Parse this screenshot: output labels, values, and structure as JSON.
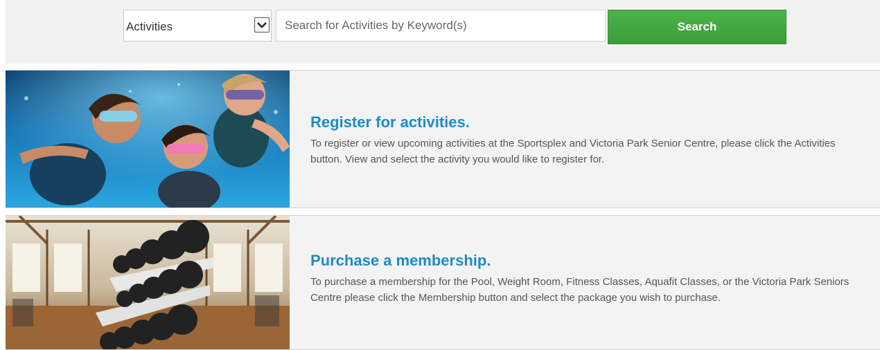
{
  "search": {
    "category_selected": "Activities",
    "keyword_placeholder": "Search for Activities by Keyword(s)",
    "keyword_value": "",
    "button_label": "Search",
    "button_color": "#43a843"
  },
  "panels": [
    {
      "image": "children-swimming-underwater-photo",
      "title": "Register for activities.",
      "description": "To register or view upcoming activities at the Sportsplex and Victoria Park Senior Centre, please click the Activities button. View and select the activity you would like to register for."
    },
    {
      "image": "gym-dumbbell-rack-photo",
      "title": "Purchase a membership.",
      "description": "To purchase a membership for the Pool, Weight Room, Fitness Classes, Aquafit Classes, or the Victoria Park Seniors Centre please click the Membership button and select the package you wish to purchase."
    }
  ],
  "colors": {
    "title_blue": "#1f8ac6",
    "panel_bg": "#f3f3f3"
  }
}
